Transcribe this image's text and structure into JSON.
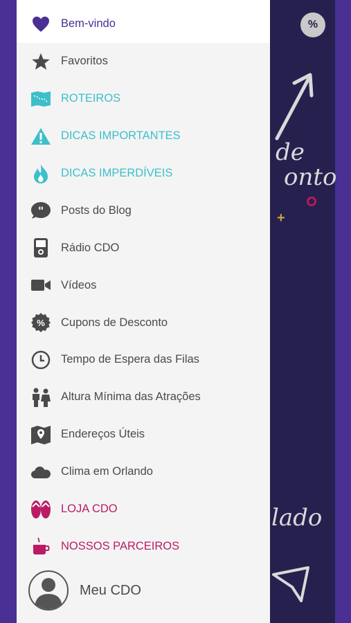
{
  "menu": {
    "items": [
      {
        "label": "Bem-vindo",
        "icon": "heart-icon"
      },
      {
        "label": "Favoritos",
        "icon": "star-icon"
      },
      {
        "label": "ROTEIROS",
        "icon": "map-route-icon"
      },
      {
        "label": "DICAS IMPORTANTES",
        "icon": "warning-icon"
      },
      {
        "label": "DICAS IMPERDÍVEIS",
        "icon": "flame-icon"
      },
      {
        "label": "Posts do Blog",
        "icon": "quote-bubble-icon"
      },
      {
        "label": "Rádio CDO",
        "icon": "radio-player-icon"
      },
      {
        "label": "Vídeos",
        "icon": "video-camera-icon"
      },
      {
        "label": "Cupons de Desconto",
        "icon": "percent-badge-icon"
      },
      {
        "label": "Tempo de Espera das Filas",
        "icon": "clock-icon"
      },
      {
        "label": "Altura Mínima das Atrações",
        "icon": "people-icon"
      },
      {
        "label": "Endereços Úteis",
        "icon": "map-pin-icon"
      },
      {
        "label": "Clima em Orlando",
        "icon": "cloud-icon"
      },
      {
        "label": "LOJA CDO",
        "icon": "flip-flops-icon"
      },
      {
        "label": "NOSSOS PARCEIROS",
        "icon": "coffee-cup-icon"
      }
    ]
  },
  "profile": {
    "label": "Meu CDO",
    "icon": "user-avatar-icon"
  },
  "background": {
    "badge": "%",
    "script_line_1": "de",
    "script_line_2": "onto",
    "script_line_3": "lado"
  },
  "colors": {
    "purple": "#4a2f94",
    "teal": "#3dbfcb",
    "pink": "#bb1b66",
    "gray": "#4a4a4a",
    "dark": "#26204e"
  }
}
